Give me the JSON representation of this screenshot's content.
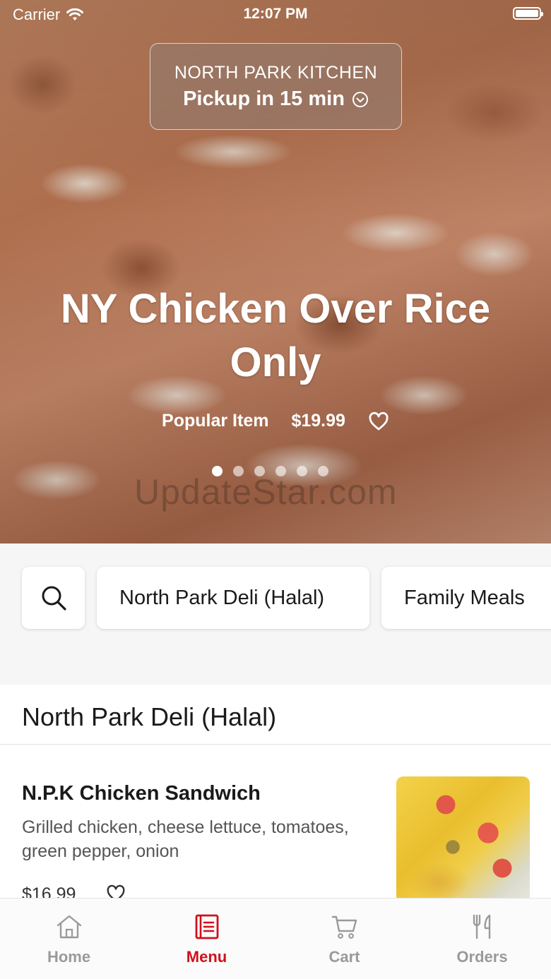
{
  "status_bar": {
    "carrier": "Carrier",
    "time": "12:07 PM"
  },
  "store": {
    "name": "NORTH PARK KITCHEN",
    "pickup": "Pickup in 15 min"
  },
  "hero": {
    "title": "NY Chicken Over Rice Only",
    "tag": "Popular Item",
    "price": "$19.99",
    "slide_count": 6,
    "active_slide": 1,
    "watermark": "UpdateStar.com"
  },
  "categories": {
    "items": [
      "North Park Deli (Halal)",
      "Family Meals"
    ]
  },
  "section": {
    "title": "North Park Deli (Halal)"
  },
  "menu_items": [
    {
      "name": "N.P.K Chicken Sandwich",
      "description": "Grilled chicken, cheese lettuce, tomatoes, green pepper, onion",
      "price": "$16.99"
    }
  ],
  "tabs": [
    {
      "label": "Home",
      "icon": "home-icon",
      "active": false
    },
    {
      "label": "Menu",
      "icon": "menu-icon",
      "active": true
    },
    {
      "label": "Cart",
      "icon": "cart-icon",
      "active": false
    },
    {
      "label": "Orders",
      "icon": "fork-knife-icon",
      "active": false
    }
  ],
  "colors": {
    "accent": "#d0101b",
    "inactive": "#9a9a9a"
  }
}
